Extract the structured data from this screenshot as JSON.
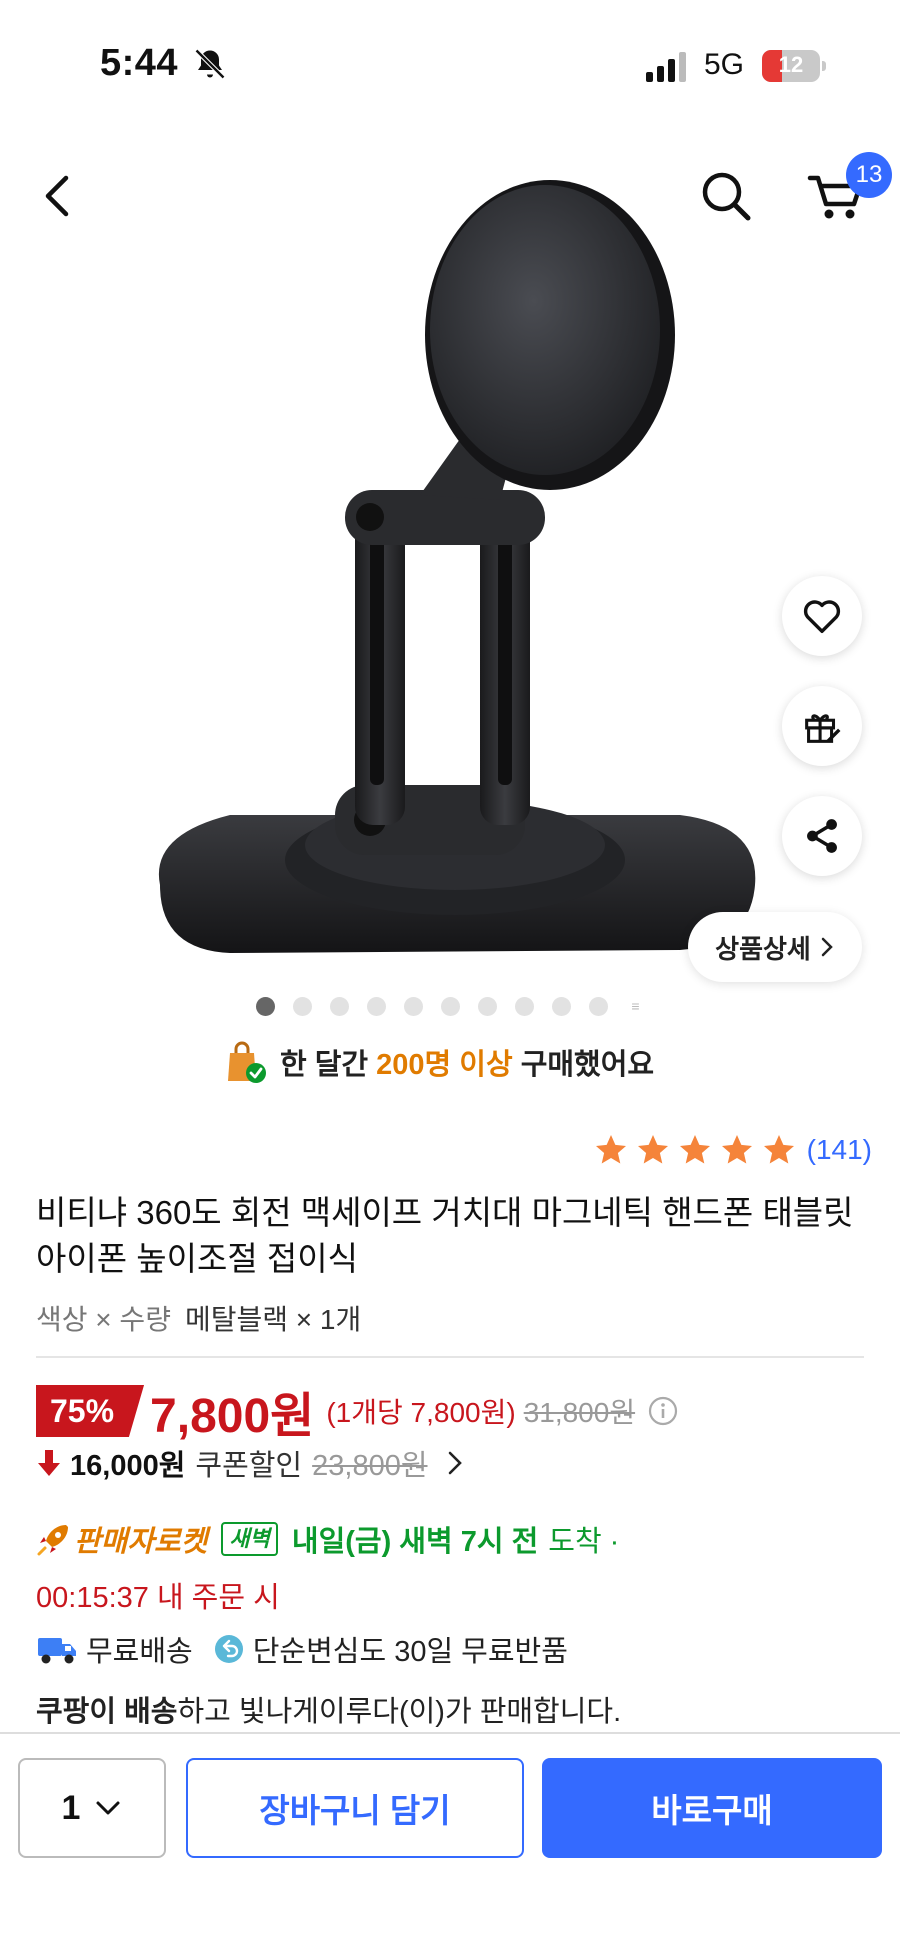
{
  "status_bar": {
    "time": "5:44",
    "network": "5G",
    "battery": "12"
  },
  "header": {
    "cart_count": "13"
  },
  "gallery": {
    "detail_label": "상품상세",
    "total_images": 10,
    "current_index": 1
  },
  "purchase_banner": {
    "prefix": "한 달간 ",
    "highlight": "200명 이상",
    "suffix": " 구매했어요"
  },
  "rating": {
    "stars": 5,
    "review_count": "(141)",
    "star_color": "#f5843a"
  },
  "product": {
    "title": "비티냐 360도 회전 맥세이프 거치대 마그네틱 핸드폰 태블릿 아이폰 높이조절 접이식",
    "option_label": "색상 × 수량",
    "option_value": "메탈블랙 × 1개"
  },
  "price": {
    "discount": "75%",
    "sale_price": "7,800원",
    "unit_price": "(1개당 7,800원)",
    "original_price": "31,800원",
    "coupon_amount": "16,000원",
    "coupon_label": "쿠폰할인",
    "coupon_original": "23,800원"
  },
  "delivery": {
    "badge": "판매자로켓",
    "dawn": "새벽",
    "arrival_bold": "내일(금) 새벽 7시 전",
    "arrival_rest": "도착 ·",
    "countdown": "00:15:37 내 주문 시",
    "free_shipping": "무료배송",
    "free_return": "단순변심도 30일 무료반품",
    "seller_bold": "쿠팡이 배송",
    "seller_rest": "하고 빛나게이루다(이)가 판매합니다."
  },
  "bottom_bar": {
    "quantity": "1",
    "cart_button": "장바구니 담기",
    "buy_button": "바로구매"
  },
  "colors": {
    "accent": "#346aff",
    "price_red": "#c8161d",
    "rocket_green": "#0c9a2d",
    "highlight_orange": "#e07b00"
  }
}
